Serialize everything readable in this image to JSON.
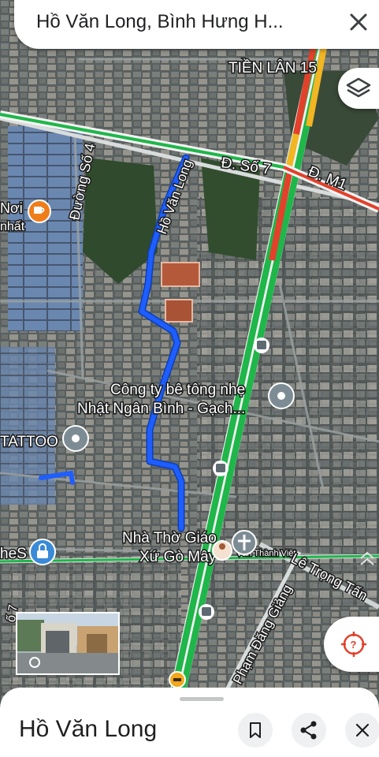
{
  "search": {
    "query": "Hồ Văn Long, Bình Hưng H..."
  },
  "map_labels": {
    "tien_lan": "TIỀN LÂN 15",
    "d_so_7": "Đ. Số 7",
    "d_m1": "Đ. M1",
    "duong_so_4": "Đường Số 4",
    "ho_van_long": "Hồ Văn Long",
    "noi": "Nơi",
    "nhat": "nhất",
    "cong_ty_line1": "Công ty bê tông nhẹ",
    "cong_ty_line2": "Nhật Ngân Bình - Gạch...",
    "tattoo": "TATTOO",
    "nha_tho_line1": "Nhà Thờ Giáo",
    "nha_tho_line2": "Xứ Gò Mây",
    "van_thanh_viet": "Văn Thành Việt",
    "hes": "heS",
    "le_trong_tan": "Lê Trọng Tấn",
    "pham_dang_giang": "Đ. Phạm Đăng Giảng",
    "so_7_left": "ố 7"
  },
  "colors": {
    "route": "#1e5eff",
    "traffic_green": "#1fb64a",
    "traffic_yellow": "#f2b622",
    "traffic_red": "#e2412b"
  },
  "icons": [
    "layers-icon",
    "locate-icon",
    "close-icon",
    "bookmark-icon",
    "share-icon",
    "cafe-pin-icon",
    "shopping-pin-icon",
    "bus-stop-icon",
    "place-pin-icon",
    "church-icon"
  ],
  "sheet": {
    "title": "Hồ Văn Long"
  }
}
